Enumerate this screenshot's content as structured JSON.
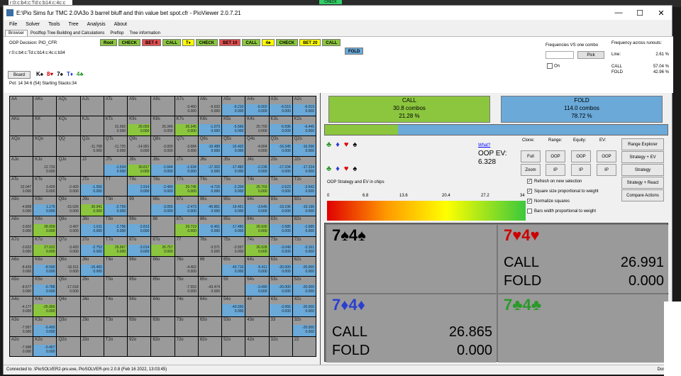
{
  "desktop": {
    "top_left": "r:0:c:b4:c:Td:c:b14:c:4c:c",
    "top_center": "CHECK"
  },
  "window": {
    "title": "E:\\Pio Sims fur TMC 2.0\\A3o 3 barrel bluff and thin value bet spot.cfr - PioViewer 2.0.7.21",
    "min": "—",
    "max": "☐",
    "close": "✕"
  },
  "menu": [
    "File",
    "Solver",
    "Tools",
    "Tree",
    "Analysis",
    "About"
  ],
  "tabs": [
    "Browser",
    "Postflop Tree Building and Calculations",
    "Preflop",
    "Tree information"
  ],
  "info": {
    "oop_decision": "OOP Decision:  PIO_CFR",
    "line": "r:0:c:b4:c:Td:c:b14:c:4c:c:b34",
    "board_btn": "Board",
    "cards": [
      "K♠",
      "8♥",
      "7♠",
      "T♦",
      "4♣"
    ],
    "pot": "Pot: 14 34 6 (54) Starting Stacks:34"
  },
  "crumbs": [
    {
      "t": "Root",
      "c": "cg"
    },
    {
      "t": "CHECK",
      "c": "cg"
    },
    {
      "t": "BET 4",
      "c": "cr"
    },
    {
      "t": "CALL",
      "c": "cg"
    },
    {
      "t": "T♦",
      "c": "cy"
    },
    {
      "t": "CHECK",
      "c": "cg"
    },
    {
      "t": "BET 10",
      "c": "cr"
    },
    {
      "t": "CALL",
      "c": "cg"
    },
    {
      "t": "4♣",
      "c": "cy"
    },
    {
      "t": "CHECK",
      "c": "cg"
    },
    {
      "t": "BET 20",
      "c": "cy"
    },
    {
      "t": "CALL",
      "c": "cg"
    }
  ],
  "fold_crumb": "FOLD",
  "right_panel": {
    "freq_label": "Frequencies VS one combo",
    "pick": "Pick",
    "on": "On",
    "runout_label": "Frequency across runouts:",
    "line_label": "Line:",
    "line_val": "2.61 %",
    "call_label": "CALL",
    "call_val": "57.04 %",
    "fold_label": "FOLD",
    "fold_val": "42.96 %"
  },
  "grid": [
    [
      "AA",
      "AKs",
      "AQs",
      "AJs",
      "ATs",
      "A9s",
      "A8s",
      "A7s",
      "A6s",
      "A5s",
      "A4s",
      "A3s",
      "A2s"
    ],
    [
      "AKo",
      "KK",
      "KQs",
      "KJs",
      "KTs",
      "K9s",
      "K8s",
      "K7s",
      "K6s",
      "K5s",
      "K4s",
      "K3s",
      "K2s"
    ],
    [
      "AQo",
      "KQo",
      "QQ",
      "QJs",
      "QTs",
      "Q9s",
      "Q8s",
      "Q7s",
      "Q6s",
      "Q5s",
      "Q4s",
      "Q3s",
      "Q2s"
    ],
    [
      "AJo",
      "KJo",
      "QJo",
      "JJ",
      "JTs",
      "J9s",
      "J8s",
      "J7s",
      "J6s",
      "J5s",
      "J4s",
      "J3s",
      "J2s"
    ],
    [
      "ATo",
      "KTo",
      "QTo",
      "JTo",
      "TT",
      "T9s",
      "T8s",
      "T7s",
      "T6s",
      "T5s",
      "T4s",
      "T3s",
      "T2s"
    ],
    [
      "A9o",
      "K9o",
      "Q9o",
      "J9o",
      "T9o",
      "99",
      "98s",
      "97s",
      "96s",
      "95s",
      "94s",
      "93s",
      "92s"
    ],
    [
      "A8o",
      "K8o",
      "Q8o",
      "J8o",
      "T8o",
      "98o",
      "88",
      "87s",
      "86s",
      "85s",
      "84s",
      "83s",
      "82s"
    ],
    [
      "A7o",
      "K7o",
      "Q7o",
      "J7o",
      "T7o",
      "97o",
      "87o",
      "77",
      "76s",
      "75s",
      "74s",
      "73s",
      "72s"
    ],
    [
      "A6o",
      "K6o",
      "Q6o",
      "J6o",
      "T6o",
      "96o",
      "86o",
      "76o",
      "66",
      "65s",
      "64s",
      "63s",
      "62s"
    ],
    [
      "A5o",
      "K5o",
      "Q5o",
      "J5o",
      "T5o",
      "95o",
      "85o",
      "75o",
      "65o",
      "55",
      "54s",
      "53s",
      "52s"
    ],
    [
      "A4o",
      "K4o",
      "Q4o",
      "J4o",
      "T4o",
      "94o",
      "84o",
      "74o",
      "64o",
      "54o",
      "44",
      "43s",
      "42s"
    ],
    [
      "A3o",
      "K3o",
      "Q3o",
      "J3o",
      "T3o",
      "93o",
      "83o",
      "73o",
      "63o",
      "53o",
      "43o",
      "33",
      "32s"
    ],
    [
      "A2o",
      "K2o",
      "Q2o",
      "J2o",
      "T2o",
      "92o",
      "82o",
      "72o",
      "62o",
      "52o",
      "42o",
      "32o",
      "22"
    ]
  ],
  "grid_vals": {
    "0,7": [
      "-3.460",
      "0.000"
    ],
    "0,8": [
      "-6.632",
      "0.000"
    ],
    "0,9": [
      "-6.210",
      "0.000"
    ],
    "0,10": [
      "-6.002",
      "0.000"
    ],
    "0,11": [
      "-6.015",
      "0.000"
    ],
    "0,12": [
      "-6.019",
      "0.000"
    ],
    "1,4": [
      "31.992",
      "0.000"
    ],
    "1,5": [
      "26.059",
      "0.000"
    ],
    "1,6": [
      "26.345",
      "0.000"
    ],
    "1,7": [
      "26.345",
      "0.000"
    ],
    "1,8": [
      "-1.073",
      "0.000"
    ],
    "1,9": [
      "-5.566",
      "0.000"
    ],
    "1,10": [
      "25.700",
      "0.000"
    ],
    "1,11": [
      "-5.596",
      "0.000"
    ],
    "1,12": [
      "-6.445",
      "0.000"
    ],
    "2,3": [
      "-11.708",
      "0.000"
    ],
    "2,4": [
      "-11.725",
      "0.000"
    ],
    "2,5": [
      "-14.991",
      "0.000"
    ],
    "2,6": [
      "-3.000",
      "0.000"
    ],
    "2,7": [
      "-3.684",
      "0.000"
    ],
    "2,8": [
      "-16.489",
      "0.000"
    ],
    "2,9": [
      "-16.402",
      "0.000"
    ],
    "2,10": [
      "-4.004",
      "0.000"
    ],
    "2,11": [
      "-16.345",
      "0.000"
    ],
    "2,12": [
      "-16.296",
      "0.000"
    ],
    "3,1": [
      "12.733",
      "0.000"
    ],
    "3,4": [
      "-1.534",
      "0.000"
    ],
    "3,5": [
      "30.817",
      "0.000"
    ],
    "3,6": [
      "-1.644",
      "0.000"
    ],
    "3,7": [
      "-1.634",
      "0.000"
    ],
    "3,8": [
      "-17.302",
      "0.000"
    ],
    "3,9": [
      "-17.482",
      "0.000"
    ],
    "3,10": [
      "-2.236",
      "0.000"
    ],
    "3,11": [
      "-17.234",
      "0.000"
    ],
    "3,12": [
      "-17.234",
      "0.000"
    ],
    "4,0": [
      "32.047",
      "0.000"
    ],
    "4,1": [
      "3.429",
      "0.000"
    ],
    "4,2": [
      "-2.420",
      "0.000"
    ],
    "4,3": [
      "-1.550",
      "0.000"
    ],
    "4,5": [
      "2.914",
      "0.000"
    ],
    "4,6": [
      "-2.490",
      "0.000"
    ],
    "4,7": [
      "29.745",
      "0.000"
    ],
    "4,8": [
      "-4.716",
      "0.000"
    ],
    "4,9": [
      "-2.334",
      "0.000"
    ],
    "4,10": [
      "25.703",
      "0.000"
    ],
    "4,11": [
      "-2.623",
      "0.000"
    ],
    "4,12": [
      "-2.642",
      "0.000"
    ],
    "5,0": [
      "-4.808",
      "0.000"
    ],
    "5,1": [
      "1.176",
      "0.000"
    ],
    "5,2": [
      "-15.026",
      "0.000"
    ],
    "5,3": [
      "30.941",
      "0.000"
    ],
    "5,4": [
      "-2.759",
      "0.000"
    ],
    "5,6": [
      "-3.055",
      "0.000"
    ],
    "5,7": [
      "-2.473",
      "0.000"
    ],
    "5,8": [
      "-45.861",
      "0.000"
    ],
    "5,9": [
      "-19.461",
      "0.000"
    ],
    "5,10": [
      "-3.645",
      "0.000"
    ],
    "5,11": [
      "-19.196",
      "0.000"
    ],
    "5,12": [
      "-19.196",
      "0.000"
    ],
    "6,0": [
      "-3.602",
      "0.000"
    ],
    "6,1": [
      "28.059",
      "0.000"
    ],
    "6,2": [
      "-3.497",
      "0.000"
    ],
    "6,3": [
      "-1.611",
      "0.000"
    ],
    "6,4": [
      "-2.796",
      "0.000"
    ],
    "6,5": [
      "-2.813",
      "0.000"
    ],
    "6,7": [
      "29.719",
      "0.000"
    ],
    "6,8": [
      "-6.451",
      "0.000"
    ],
    "6,9": [
      "-17.480",
      "0.000"
    ],
    "6,10": [
      "26.930",
      "0.000"
    ],
    "6,11": [
      "-2.685",
      "0.000"
    ],
    "6,12": [
      "-2.685",
      "0.000"
    ],
    "7,0": [
      "-3.622",
      "0.000"
    ],
    "7,1": [
      "27.022",
      "0.000"
    ],
    "7,2": [
      "-3.420",
      "0.000"
    ],
    "7,3": [
      "-2.753",
      "0.000"
    ],
    "7,4": [
      "25.967",
      "0.000"
    ],
    "7,5": [
      "-3.014",
      "0.000"
    ],
    "7,6": [
      "26.757",
      "0.000"
    ],
    "7,8": [
      "-3.571",
      "0.000"
    ],
    "7,9": [
      "-3.557",
      "0.000"
    ],
    "7,10": [
      "26.928",
      "0.000"
    ],
    "7,11": [
      "-3.049",
      "0.000"
    ],
    "7,12": [
      "-3.161",
      "0.000"
    ],
    "8,0": [
      "-8.433",
      "0.000"
    ],
    "8,1": [
      "-8.590",
      "0.000"
    ],
    "8,2": [
      "-16.511",
      "0.000"
    ],
    "8,3": [
      "-16.460",
      "0.000"
    ],
    "8,7": [
      "-4.402",
      "0.000"
    ],
    "8,9": [
      "-43.719",
      "0.000"
    ],
    "8,10": [
      "-5.411",
      "0.000"
    ],
    "8,11": [
      "-20.000",
      "0.000"
    ],
    "8,12": [
      "-20.000",
      "0.000"
    ],
    "9,0": [
      "-8.577",
      "0.000"
    ],
    "9,1": [
      "-0.788",
      "0.000"
    ],
    "9,2": [
      "-17.018",
      "0.000"
    ],
    "9,7": [
      "-7.553",
      "0.000"
    ],
    "9,8": [
      "-43.474",
      "0.000"
    ],
    "9,10": [
      "-3.490",
      "0.000"
    ],
    "9,11": [
      "-20.000",
      "0.000"
    ],
    "9,12": [
      "-20.000",
      "0.000"
    ],
    "10,0": [
      "-4.177",
      "0.000"
    ],
    "10,1": [
      "-25.950",
      "0.000"
    ],
    "10,9": [
      "-43.550",
      "0.000"
    ],
    "10,11": [
      "-3.955",
      "0.000"
    ],
    "10,12": [
      "-20.000",
      "0.000"
    ],
    "11,0": [
      "-7.957",
      "0.000"
    ],
    "11,1": [
      "-0.400",
      "0.000"
    ],
    "11,12": [
      "-20.000",
      "0.000"
    ],
    "12,0": [
      "-7.998",
      "0.000"
    ],
    "12,1": [
      "-0.457",
      "0.000"
    ]
  },
  "grid_bars": {
    "0,9": "b",
    "0,10": "b",
    "0,11": "b",
    "0,12": "b",
    "1,5": "g",
    "1,7": "g",
    "1,8": "b",
    "1,9": "b",
    "1,11": "b",
    "1,12": "b",
    "2,8": "b",
    "2,9": "b",
    "2,11": "b",
    "2,12": "b",
    "3,4": "b",
    "3,5": "g",
    "3,6": "b",
    "3,7": "b",
    "3,8": "b",
    "3,9": "b",
    "3,10": "b",
    "3,11": "b",
    "3,12": "b",
    "4,3": "b",
    "4,5": "b",
    "4,6": "b",
    "4,7": "g",
    "4,8": "b",
    "4,9": "b",
    "4,10": "g",
    "4,11": "b",
    "4,12": "b",
    "5,1": "b",
    "5,3": "g",
    "5,4": "b",
    "5,6": "b",
    "5,7": "b",
    "5,8": "b",
    "5,9": "b",
    "5,10": "b",
    "5,11": "b",
    "5,12": "b",
    "6,1": "g",
    "6,3": "b",
    "6,4": "b",
    "6,5": "b",
    "6,7": "g",
    "6,8": "b",
    "6,9": "b",
    "6,10": "g",
    "6,11": "b",
    "6,12": "b",
    "7,1": "g",
    "7,3": "b",
    "7,4": "g",
    "7,5": "b",
    "7,6": "g",
    "7,10": "g",
    "7,11": "b",
    "7,12": "b",
    "8,1": "b",
    "8,3": "b",
    "8,9": "b",
    "8,10": "b",
    "8,11": "b",
    "8,12": "b",
    "9,1": "b",
    "9,10": "b",
    "9,11": "b",
    "9,12": "b",
    "10,1": "g",
    "10,9": "b",
    "10,11": "b",
    "10,12": "b",
    "11,1": "b",
    "11,12": "b",
    "12,1": "b"
  },
  "summary": {
    "call_label": "CALL",
    "call_combos": "30.8 combos",
    "call_pct": "21.28 %",
    "fold_label": "FOLD",
    "fold_combos": "114.0 combos",
    "fold_pct": "78.72 %",
    "call_frac": 0.2128
  },
  "suits1": "♣♦♥♠",
  "suits2": "♣♦♥♠",
  "what": "What?",
  "oop_ev_label": "OOP EV:",
  "oop_ev_val": "6.328",
  "col_headers": {
    "clone": "Clone:",
    "range": "Range:",
    "equity": "Equity:",
    "ev": "EV:"
  },
  "btns": {
    "full": "Full",
    "zoom": "Zoom",
    "oop1": "OOP",
    "ip1": "IP",
    "oop2": "OOP",
    "ip2": "IP",
    "oop3": "OOP",
    "ip3": "IP",
    "range_explorer": "Range Explorer",
    "strategy_ev": "Strategy + EV",
    "strategy": "Strategy",
    "strategy_react": "Strategy + React",
    "compare": "Compare Actions"
  },
  "checks": {
    "refresh": "Refresh on new selection",
    "square": "Square size proportional to weight",
    "normalize": "Normalize squares",
    "bars": "Bars width proportional to weight"
  },
  "gradient_label": "OOP Strategy and EV in chips",
  "scale": [
    "0",
    "6.8",
    "13.6",
    "20.4",
    "27.2",
    "34"
  ],
  "combos": [
    {
      "cards": "7♠4♠",
      "color": "#000",
      "call": "",
      "fold": ""
    },
    {
      "cards": "7♥4♥",
      "color": "#c00",
      "call": "26.991",
      "fold": "0.000"
    },
    {
      "cards": "7♦4♦",
      "color": "#2a3fd0",
      "call": "26.865",
      "fold": "0.000"
    },
    {
      "cards": "7♣4♣",
      "color": "#2a9a2a",
      "call": "",
      "fold": ""
    }
  ],
  "combo_call": "CALL",
  "combo_fold": "FOLD",
  "status": "Connected to .\\PioSOLVER2-pro.exe, PioSOLVER-pro 2.0.8 (Feb 16 2022, 13:03:45)",
  "status_right": "Done"
}
